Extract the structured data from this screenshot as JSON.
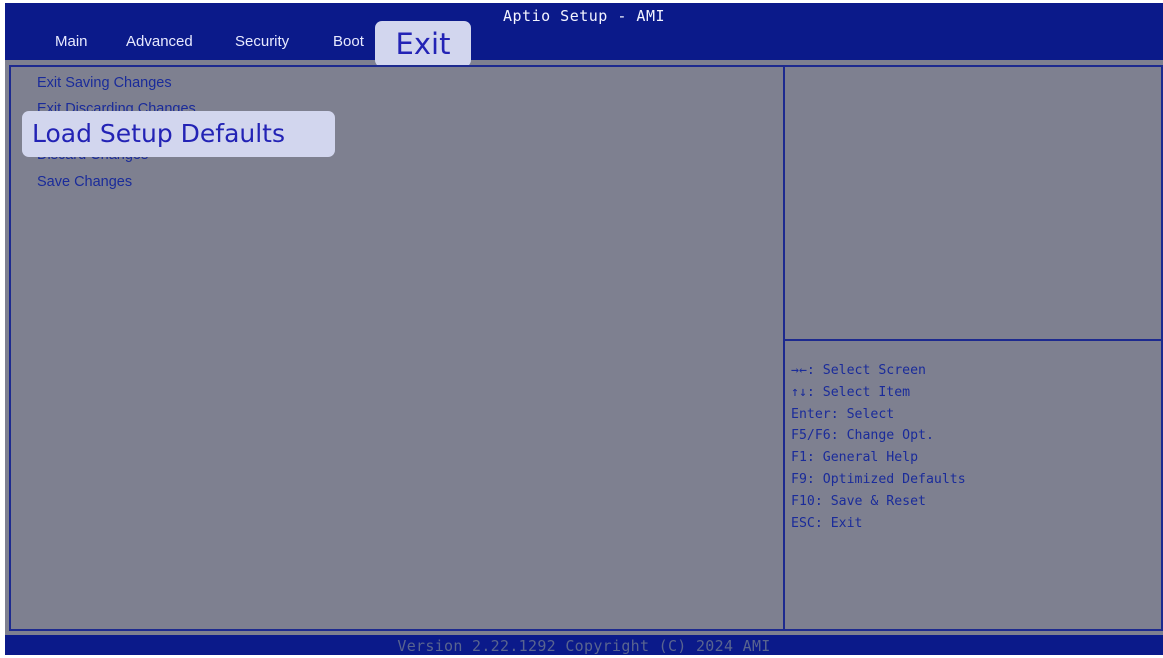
{
  "window": {
    "title": "Aptio Setup - AMI"
  },
  "tabs": [
    {
      "label": "Main"
    },
    {
      "label": "Advanced"
    },
    {
      "label": "Security"
    },
    {
      "label": "Boot"
    },
    {
      "label": "Exit",
      "active": true
    }
  ],
  "menu": {
    "items": [
      {
        "label": "Exit Saving Changes"
      },
      {
        "label": "Exit Discarding Changes"
      },
      {
        "label": "Load Setup Defaults",
        "selected": true
      },
      {
        "label": "Discard Changes"
      },
      {
        "label": "Save Changes"
      }
    ]
  },
  "help": {
    "lines": [
      "→←: Select Screen",
      "↑↓: Select Item",
      "Enter: Select",
      "F5/F6: Change Opt.",
      "F1: General Help",
      "F9: Optimized Defaults",
      "F10: Save & Reset",
      "ESC: Exit"
    ]
  },
  "footer": {
    "text": "Version 2.22.1292 Copyright (C) 2024 AMI"
  },
  "colors": {
    "background": "#7e8090",
    "header": "#0b1a8a",
    "text": "#1a2b9a",
    "highlight": "#d2d6ee",
    "highlight_text": "#2323b5"
  }
}
